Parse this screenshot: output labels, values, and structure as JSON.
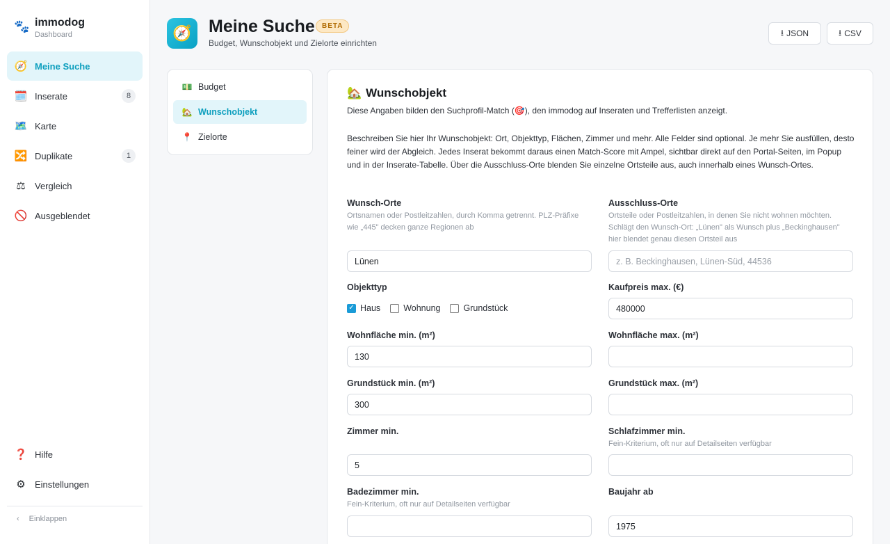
{
  "brand": {
    "icon": "paw-icon",
    "name": "immodog",
    "sub": "Dashboard"
  },
  "nav": [
    {
      "icon": "🧭",
      "label": "Meine Suche",
      "badge": null,
      "active": true
    },
    {
      "icon": "🗓️",
      "label": "Inserate",
      "badge": "8",
      "active": false
    },
    {
      "icon": "🗺️",
      "label": "Karte",
      "badge": null,
      "active": false
    },
    {
      "icon": "🔀",
      "label": "Duplikate",
      "badge": "1",
      "active": false
    },
    {
      "icon": "⚖",
      "label": "Vergleich",
      "badge": null,
      "active": false
    },
    {
      "icon": "🚫",
      "label": "Ausgeblendet",
      "badge": null,
      "active": false
    }
  ],
  "nav_bottom": [
    {
      "icon": "❓",
      "label": "Hilfe"
    },
    {
      "icon": "⚙",
      "label": "Einstellungen"
    }
  ],
  "collapse_label": "Einklappen",
  "header": {
    "icon": "🧭",
    "title": "Meine Suche",
    "badge": "BETA",
    "subtitle": "Budget, Wunschobjekt und Zielorte einrichten",
    "json_label": "JSON",
    "csv_label": "CSV"
  },
  "subnav": [
    {
      "icon": "💵",
      "label": "Budget",
      "active": false
    },
    {
      "icon": "🏡",
      "label": "Wunschobjekt",
      "active": true
    },
    {
      "icon": "📍",
      "label": "Zielorte",
      "active": false
    }
  ],
  "card": {
    "icon": "🏡",
    "title": "Wunschobjekt",
    "lead": "Diese Angaben bilden den Suchprofil-Match (🎯), den immodog auf Inseraten und Trefferlisten anzeigt.",
    "description": "Beschreiben Sie hier Ihr Wunschobjekt: Ort, Objekttyp, Flächen, Zimmer und mehr. Alle Felder sind optional. Je mehr Sie ausfüllen, desto feiner wird der Abgleich. Jedes Inserat bekommt daraus einen Match-Score mit Ampel, sichtbar direkt auf den Portal-Seiten, im Popup und in der Inserate-Tabelle. Über die Ausschluss-Orte blenden Sie einzelne Ortsteile aus, auch innerhalb eines Wunsch-Ortes."
  },
  "fields": {
    "wunsch_orte": {
      "label": "Wunsch-Orte",
      "hint": "Ortsnamen oder Postleitzahlen, durch Komma getrennt. PLZ-Präfixe wie „445\" decken ganze Regionen ab",
      "value": "Lünen",
      "placeholder": ""
    },
    "ausschluss_orte": {
      "label": "Ausschluss-Orte",
      "hint": "Ortsteile oder Postleitzahlen, in denen Sie nicht wohnen möchten. Schlägt den Wunsch-Ort: „Lünen\" als Wunsch plus „Beckinghausen\" hier blendet genau diesen Ortsteil aus",
      "value": "",
      "placeholder": "z. B. Beckinghausen, Lünen-Süd, 44536"
    },
    "objekttyp": {
      "label": "Objekttyp",
      "options": [
        {
          "label": "Haus",
          "checked": true
        },
        {
          "label": "Wohnung",
          "checked": false
        },
        {
          "label": "Grundstück",
          "checked": false
        }
      ]
    },
    "kaufpreis_max": {
      "label": "Kaufpreis max. (€)",
      "value": "480000"
    },
    "wohnflaeche_min": {
      "label": "Wohnfläche min. (m²)",
      "value": "130"
    },
    "wohnflaeche_max": {
      "label": "Wohnfläche max. (m²)",
      "value": ""
    },
    "grundstueck_min": {
      "label": "Grundstück min. (m²)",
      "value": "300"
    },
    "grundstueck_max": {
      "label": "Grundstück max. (m²)",
      "value": ""
    },
    "zimmer_min": {
      "label": "Zimmer min.",
      "value": "5"
    },
    "schlafzimmer_min": {
      "label": "Schlafzimmer min.",
      "hint": "Fein-Kriterium, oft nur auf Detailseiten verfügbar",
      "value": ""
    },
    "badezimmer_min": {
      "label": "Badezimmer min.",
      "hint": "Fein-Kriterium, oft nur auf Detailseiten verfügbar",
      "value": ""
    },
    "baujahr_ab": {
      "label": "Baujahr ab",
      "value": "1975"
    }
  },
  "colors": {
    "accent": "#0e9fbe",
    "accent_bg": "#e2f5fa",
    "badge_bg": "#fde8c4"
  }
}
